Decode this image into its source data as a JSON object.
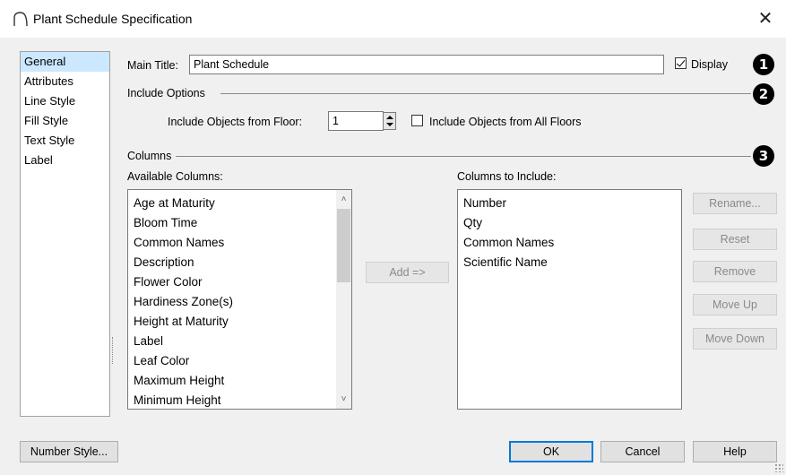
{
  "window": {
    "title": "Plant Schedule Specification",
    "close_glyph": "✕"
  },
  "nav": {
    "items": [
      "General",
      "Attributes",
      "Line Style",
      "Fill Style",
      "Text Style",
      "Label"
    ],
    "selected": 0
  },
  "main_title": {
    "label": "Main Title:",
    "value": "Plant Schedule",
    "display_label": "Display",
    "display_checked": true
  },
  "include_options": {
    "group_label": "Include Options",
    "floor_label": "Include Objects from Floor:",
    "floor_value": "1",
    "all_floors_label": "Include Objects from All Floors",
    "all_floors_checked": false
  },
  "columns": {
    "group_label": "Columns",
    "available_label": "Available Columns:",
    "available": [
      "Age at Maturity",
      "Bloom Time",
      "Common Names",
      "Description",
      "Flower Color",
      "Hardiness Zone(s)",
      "Height at Maturity",
      "Label",
      "Leaf Color",
      "Maximum Height",
      "Minimum Height"
    ],
    "include_label": "Columns to Include:",
    "included": [
      "Number",
      "Qty",
      "Common Names",
      "Scientific Name"
    ],
    "add_button": "Add =>",
    "rename_button": "Rename...",
    "reset_button": "Reset",
    "remove_button": "Remove",
    "move_up_button": "Move Up",
    "move_down_button": "Move Down"
  },
  "callouts": [
    "1",
    "2",
    "3"
  ],
  "footer": {
    "number_style": "Number Style...",
    "ok": "OK",
    "cancel": "Cancel",
    "help": "Help"
  },
  "colors": {
    "accent": "#0078d7",
    "selection": "#cce8ff",
    "dialog_bg": "#f0f0f0"
  }
}
